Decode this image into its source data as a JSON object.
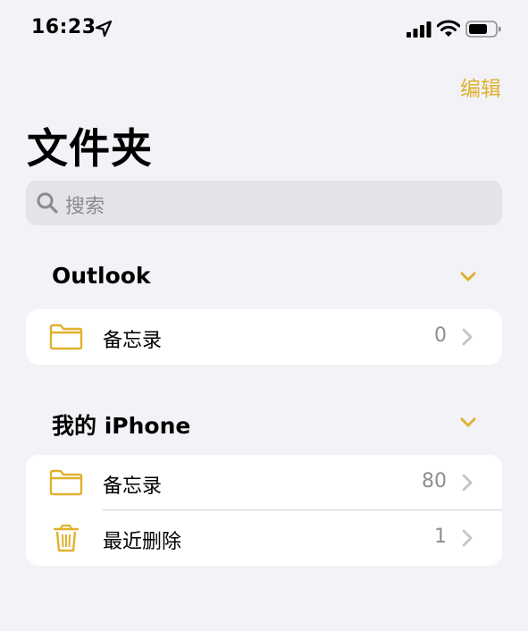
{
  "status_bar": {
    "time": "16:23",
    "icons": [
      "location-arrow-icon",
      "cellular-signal-icon",
      "wifi-icon",
      "battery-icon"
    ]
  },
  "header": {
    "edit_label": "编辑",
    "title": "文件夹"
  },
  "search": {
    "placeholder": "搜索"
  },
  "sections": [
    {
      "title": "Outlook",
      "rows": [
        {
          "icon": "folder-icon",
          "label": "备忘录",
          "count": "0"
        }
      ]
    },
    {
      "title": "我的 iPhone",
      "rows": [
        {
          "icon": "folder-icon",
          "label": "备忘录",
          "count": "80"
        },
        {
          "icon": "trash-icon",
          "label": "最近删除",
          "count": "1"
        }
      ]
    }
  ],
  "colors": {
    "accent": "#e0b12f",
    "background": "#f2f2f7",
    "card": "#ffffff",
    "secondary_text": "#8e8e93"
  }
}
